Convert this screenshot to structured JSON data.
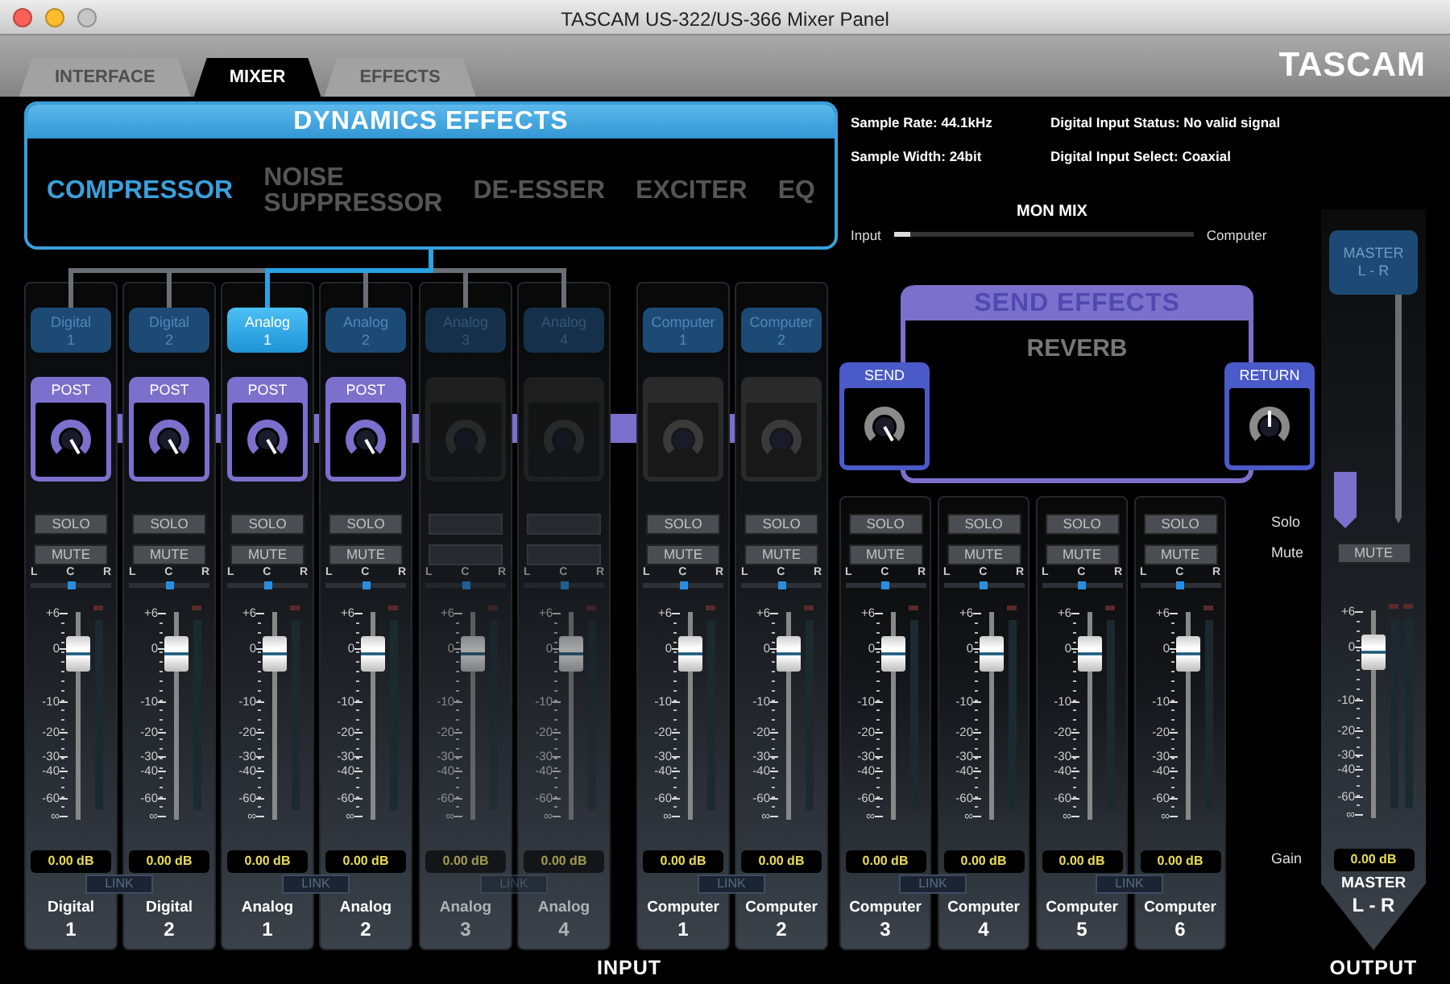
{
  "window": {
    "title": "TASCAM US-322/US-366 Mixer Panel",
    "zoom_enabled": false
  },
  "tabs": [
    {
      "label": "INTERFACE",
      "selected": false
    },
    {
      "label": "MIXER",
      "selected": true
    },
    {
      "label": "EFFECTS",
      "selected": false
    }
  ],
  "logo": "TASCAM",
  "dynamics_effects": {
    "title": "DYNAMICS EFFECTS",
    "options": [
      {
        "label": "COMPRESSOR",
        "selected": true
      },
      {
        "label": "NOISE\nSUPPRESSOR",
        "selected": false
      },
      {
        "label": "DE-ESSER",
        "selected": false
      },
      {
        "label": "EXCITER",
        "selected": false
      },
      {
        "label": "EQ",
        "selected": false
      }
    ]
  },
  "status_info": [
    "Sample Rate: 44.1kHz",
    "Digital Input Status: No valid signal",
    "Sample Width: 24bit",
    "Digital Input Select: Coaxial"
  ],
  "mon_mix": {
    "title": "MON MIX",
    "left_label": "Input",
    "right_label": "Computer",
    "level": 0
  },
  "channels": [
    {
      "source": {
        "label": "Digital\n1",
        "selected": false,
        "connected": true
      },
      "effect_send": {
        "label": "POST",
        "active": true
      },
      "disabled": false,
      "solo": "SOLO",
      "mute": "MUTE",
      "pan": {
        "left": "L",
        "center": "C",
        "right": "R",
        "level": 0.5
      },
      "scale": [
        "+6",
        "0",
        "-10",
        "-20",
        "-30",
        "-40",
        "-60",
        "∞"
      ],
      "fader": {
        "level": 0.8
      },
      "readout": "0.00 dB",
      "link": "LINK",
      "name": "Digital",
      "number": "1"
    },
    {
      "source": {
        "label": "Digital\n2",
        "selected": false,
        "connected": true
      },
      "effect_send": {
        "label": "POST",
        "active": true
      },
      "disabled": false,
      "solo": "SOLO",
      "mute": "MUTE",
      "pan": {
        "left": "L",
        "center": "C",
        "right": "R",
        "level": 0.5
      },
      "scale": [
        "+6",
        "0",
        "-10",
        "-20",
        "-30",
        "-40",
        "-60",
        "∞"
      ],
      "fader": {
        "level": 0.8
      },
      "readout": "0.00 dB",
      "name": "Digital",
      "number": "2"
    },
    {
      "source": {
        "label": "Analog\n1",
        "selected": true,
        "connected": true
      },
      "effect_send": {
        "label": "POST",
        "active": true
      },
      "disabled": false,
      "solo": "SOLO",
      "mute": "MUTE",
      "pan": {
        "left": "L",
        "center": "C",
        "right": "R",
        "level": 0.5
      },
      "scale": [
        "+6",
        "0",
        "-10",
        "-20",
        "-30",
        "-40",
        "-60",
        "∞"
      ],
      "fader": {
        "level": 0.8
      },
      "readout": "0.00 dB",
      "link": "LINK",
      "name": "Analog",
      "number": "1"
    },
    {
      "source": {
        "label": "Analog\n2",
        "selected": false,
        "connected": true
      },
      "effect_send": {
        "label": "POST",
        "active": true
      },
      "disabled": false,
      "solo": "SOLO",
      "mute": "MUTE",
      "pan": {
        "left": "L",
        "center": "C",
        "right": "R",
        "level": 0.5
      },
      "scale": [
        "+6",
        "0",
        "-10",
        "-20",
        "-30",
        "-40",
        "-60",
        "∞"
      ],
      "fader": {
        "level": 0.8
      },
      "readout": "0.00 dB",
      "name": "Analog",
      "number": "2"
    },
    {
      "source": {
        "label": "Analog\n3",
        "selected": false,
        "connected": true
      },
      "effect_send": {
        "active": false
      },
      "disabled": true,
      "pan": {
        "left": "L",
        "center": "C",
        "right": "R",
        "level": 0.5
      },
      "scale": [
        "+6",
        "0",
        "-10",
        "-20",
        "-30",
        "-40",
        "-60",
        "∞"
      ],
      "fader": {
        "level": 0.8
      },
      "readout": "0.00 dB",
      "link": "LINK",
      "name": "Analog",
      "number": "3"
    },
    {
      "source": {
        "label": "Analog\n4",
        "selected": false,
        "connected": true
      },
      "effect_send": {
        "active": false
      },
      "disabled": true,
      "pan": {
        "left": "L",
        "center": "C",
        "right": "R",
        "level": 0.5
      },
      "scale": [
        "+6",
        "0",
        "-10",
        "-20",
        "-30",
        "-40",
        "-60",
        "∞"
      ],
      "fader": {
        "level": 0.8
      },
      "readout": "0.00 dB",
      "name": "Analog",
      "number": "4"
    },
    {
      "source": {
        "label": "Computer\n1",
        "selected": false,
        "connected": false
      },
      "effect_send": {
        "active": false
      },
      "disabled": false,
      "solo": "SOLO",
      "mute": "MUTE",
      "pan": {
        "left": "L",
        "center": "C",
        "right": "R",
        "level": 0.5
      },
      "scale": [
        "+6",
        "0",
        "-10",
        "-20",
        "-30",
        "-40",
        "-60",
        "∞"
      ],
      "fader": {
        "level": 0.8
      },
      "readout": "0.00 dB",
      "link": "LINK",
      "name": "Computer",
      "number": "1"
    },
    {
      "source": {
        "label": "Computer\n2",
        "selected": false,
        "connected": false
      },
      "effect_send": {
        "active": false
      },
      "disabled": false,
      "solo": "SOLO",
      "mute": "MUTE",
      "pan": {
        "left": "L",
        "center": "C",
        "right": "R",
        "level": 0.5
      },
      "scale": [
        "+6",
        "0",
        "-10",
        "-20",
        "-30",
        "-40",
        "-60",
        "∞"
      ],
      "fader": {
        "level": 0.8
      },
      "readout": "0.00 dB",
      "name": "Computer",
      "number": "2"
    },
    {
      "disabled": false,
      "solo": "SOLO",
      "mute": "MUTE",
      "pan": {
        "left": "L",
        "center": "C",
        "right": "R",
        "level": 0.5
      },
      "scale": [
        "+6",
        "0",
        "-10",
        "-20",
        "-30",
        "-40",
        "-60",
        "∞"
      ],
      "fader": {
        "level": 0.8
      },
      "readout": "0.00 dB",
      "link": "LINK",
      "name": "Computer",
      "number": "3"
    },
    {
      "disabled": false,
      "solo": "SOLO",
      "mute": "MUTE",
      "pan": {
        "left": "L",
        "center": "C",
        "right": "R",
        "level": 0.5
      },
      "scale": [
        "+6",
        "0",
        "-10",
        "-20",
        "-30",
        "-40",
        "-60",
        "∞"
      ],
      "fader": {
        "level": 0.8
      },
      "readout": "0.00 dB",
      "name": "Computer",
      "number": "4"
    },
    {
      "disabled": false,
      "solo": "SOLO",
      "mute": "MUTE",
      "pan": {
        "left": "L",
        "center": "C",
        "right": "R",
        "level": 0.5
      },
      "scale": [
        "+6",
        "0",
        "-10",
        "-20",
        "-30",
        "-40",
        "-60",
        "∞"
      ],
      "fader": {
        "level": 0.8
      },
      "readout": "0.00 dB",
      "link": "LINK",
      "name": "Computer",
      "number": "5"
    },
    {
      "disabled": false,
      "solo": "SOLO",
      "mute": "MUTE",
      "pan": {
        "left": "L",
        "center": "C",
        "right": "R",
        "level": 0.5
      },
      "scale": [
        "+6",
        "0",
        "-10",
        "-20",
        "-30",
        "-40",
        "-60",
        "∞"
      ],
      "fader": {
        "level": 0.8
      },
      "readout": "0.00 dB",
      "name": "Computer",
      "number": "6"
    }
  ],
  "send_effects": {
    "title": "SEND EFFECTS",
    "effect": "REVERB",
    "send": "SEND",
    "return": "RETURN"
  },
  "strip_labels": [
    "Solo",
    "Mute",
    "Gain"
  ],
  "master": {
    "button": "MASTER\nL - R",
    "mute": "MUTE",
    "scale": [
      "+6",
      "0",
      "-10",
      "-20",
      "-30",
      "-40",
      "-60",
      "∞"
    ],
    "fader": {
      "level": 0.8
    },
    "readout": "0.00 dB",
    "name": "MASTER",
    "number": "L - R"
  },
  "sections": {
    "input": "INPUT",
    "output": "OUTPUT"
  }
}
